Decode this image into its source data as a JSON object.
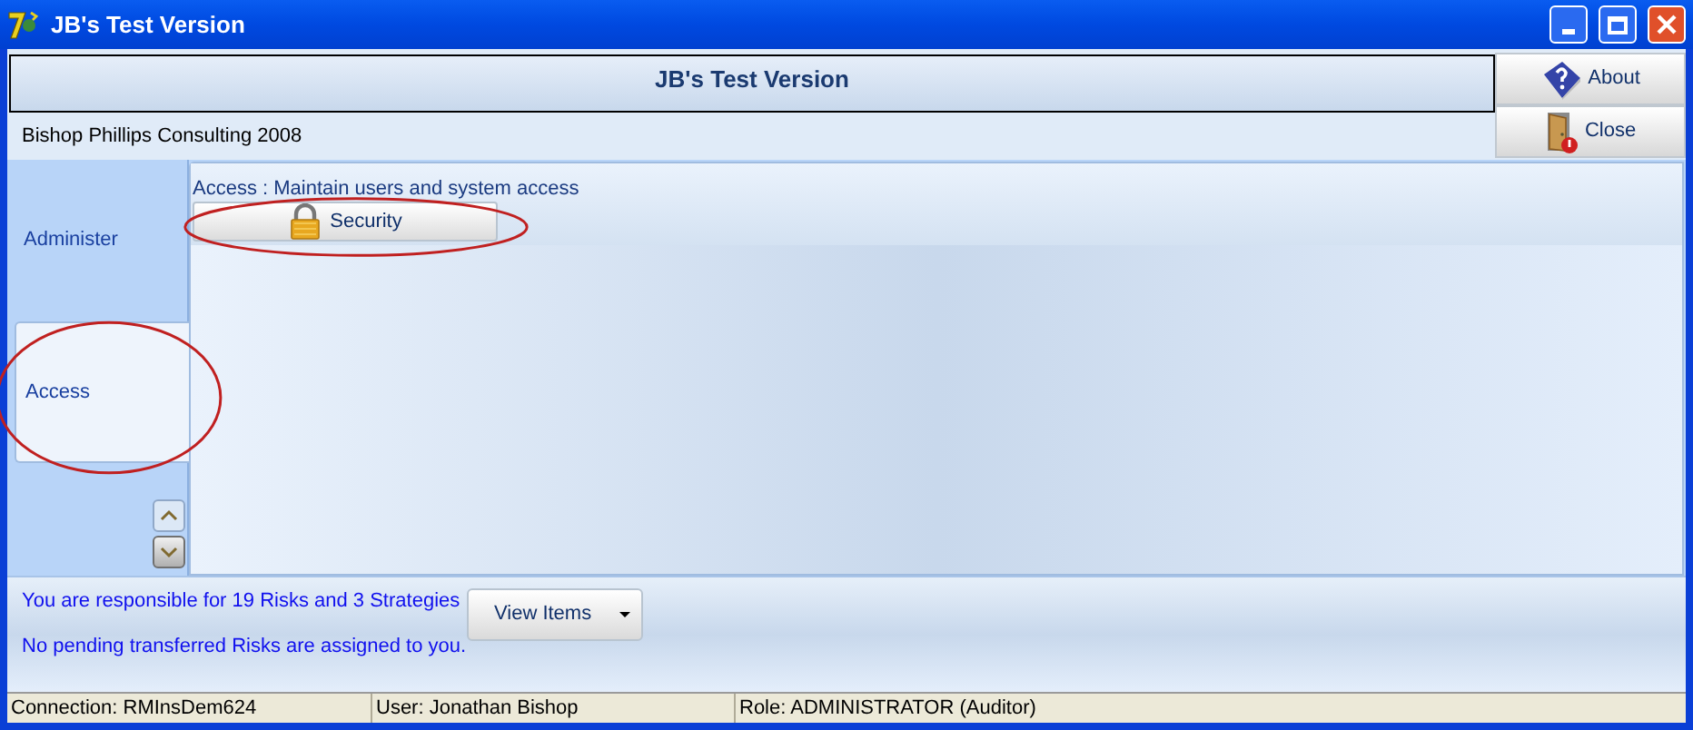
{
  "window": {
    "title": "JB's Test Version"
  },
  "header": {
    "title": "JB's Test Version",
    "company": "Bishop Phillips Consulting 2008"
  },
  "header_buttons": [
    {
      "kind": "about",
      "label": "About"
    },
    {
      "kind": "close",
      "label": "Close"
    }
  ],
  "tabs": [
    {
      "label": "Administer",
      "selected": false,
      "circled": false
    },
    {
      "label": "Access",
      "selected": true,
      "circled": true
    }
  ],
  "panel": {
    "caption": "Access : Maintain users and system access",
    "buttons": [
      {
        "label": "Security",
        "circled": true
      }
    ]
  },
  "messages": [
    "You are responsible for 19 Risks and 3 Strategies",
    "No pending transferred Risks are assigned to you."
  ],
  "view_button": {
    "label": "View Items"
  },
  "status_bar": [
    "Connection: RMInsDem624",
    "User: Jonathan Bishop",
    "Role: ADMINISTRATOR (Auditor)"
  ]
}
